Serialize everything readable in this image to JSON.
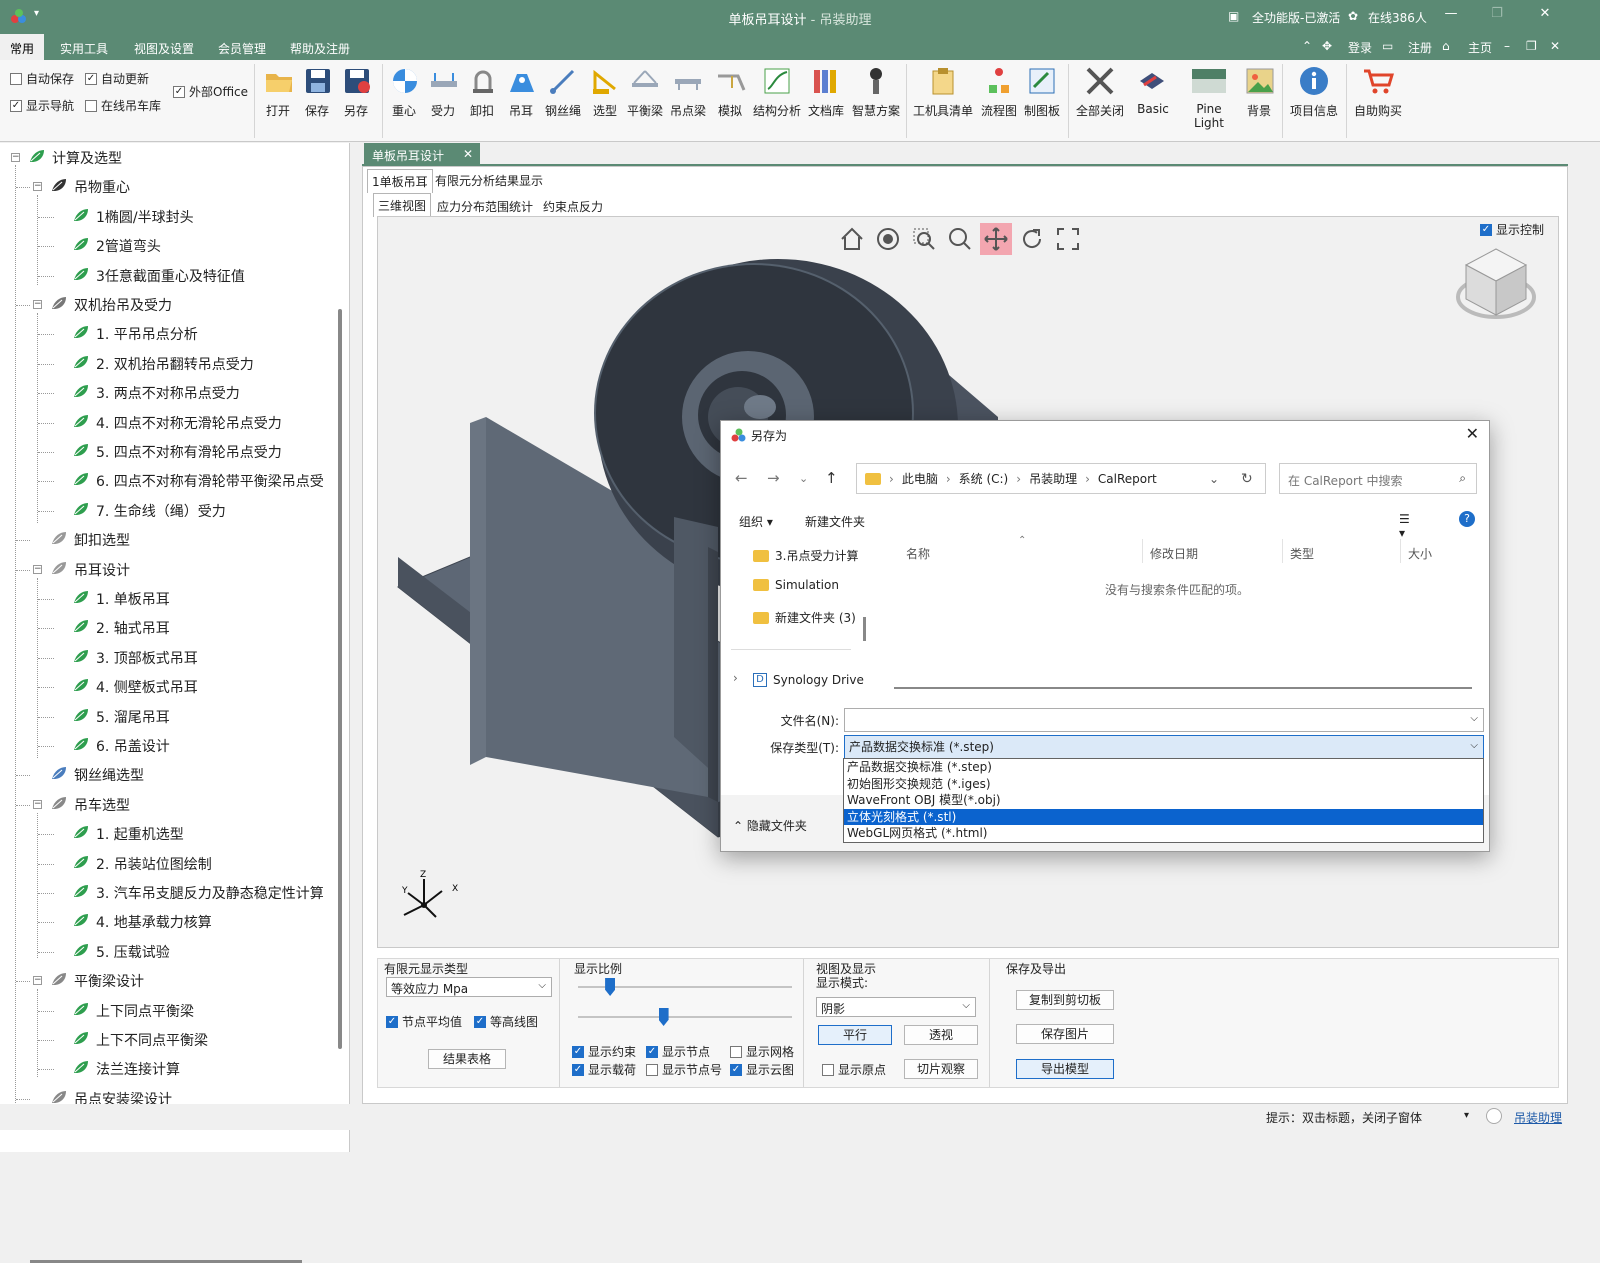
{
  "window": {
    "title": "单板吊耳设计",
    "title_sub": " - 吊装助理",
    "license": "全功能版-已激活",
    "online": "在线386人"
  },
  "menu": {
    "items": [
      "常用",
      "实用工具",
      "视图及设置",
      "会员管理",
      "帮助及注册"
    ],
    "right": {
      "login": "登录",
      "register": "注册",
      "home": "主页"
    }
  },
  "ribbon": {
    "checks": [
      {
        "label": "自动保存",
        "checked": false
      },
      {
        "label": "自动更新",
        "checked": true
      },
      {
        "label": "外部Office",
        "checked": true
      },
      {
        "label": "显示导航",
        "checked": true
      },
      {
        "label": "在线吊车库",
        "checked": false
      }
    ],
    "buttons": [
      "打开",
      "保存",
      "另存",
      "重心",
      "受力",
      "卸扣",
      "吊耳",
      "钢丝绳",
      "选型",
      "平衡梁",
      "吊点梁",
      "模拟",
      "结构分析",
      "文档库",
      "智慧方案",
      "工机具清单",
      "流程图",
      "制图板",
      "全部关闭",
      "Basic",
      "Pine Light",
      "背景",
      "项目信息",
      "自助购买"
    ]
  },
  "tree": {
    "items": [
      "计算及选型",
      "吊物重心",
      "1椭圆/半球封头",
      "2管道弯头",
      "3任意截面重心及特征值",
      "双机抬吊及受力",
      "1. 平吊吊点分析",
      "2. 双机抬吊翻转吊点受力",
      "3. 两点不对称吊点受力",
      "4. 四点不对称无滑轮吊点受力",
      "5. 四点不对称有滑轮吊点受力",
      "6. 四点不对称有滑轮带平衡梁吊点受",
      "7. 生命线（绳）受力",
      "卸扣选型",
      "吊耳设计",
      "1. 单板吊耳",
      "2. 轴式吊耳",
      "3. 顶部板式吊耳",
      "4. 侧壁板式吊耳",
      "5. 溜尾吊耳",
      "6. 吊盖设计",
      "钢丝绳选型",
      "吊车选型",
      "1. 起重机选型",
      "2. 吊装站位图绘制",
      "3. 汽车吊支腿反力及静态稳定性计算",
      "4. 地基承载力核算",
      "5. 压载试验",
      "平衡梁设计",
      "上下同点平衡梁",
      "上下不同点平衡梁",
      "法兰连接计算",
      "吊点安装梁设计"
    ]
  },
  "doc": {
    "tab": "单板吊耳设计",
    "subtabs": [
      "1单板吊耳",
      "有限元分析结果显示"
    ],
    "viewtabs": [
      "三维视图",
      "应力分布范围统计",
      "约束点反力"
    ],
    "show_control": "显示控制",
    "axes": {
      "x": "X",
      "y": "Y",
      "z": "Z"
    }
  },
  "bottom": {
    "fe_type": {
      "title": "有限元显示类型",
      "value": "等效应力 Mpa",
      "node_avg": "节点平均值",
      "contour": "等高线图",
      "result_table": "结果表格"
    },
    "scale": {
      "title": "显示比例",
      "slider1": 0.15,
      "slider2": 0.4,
      "checks": [
        {
          "label": "显示约束",
          "checked": true
        },
        {
          "label": "显示节点",
          "checked": true
        },
        {
          "label": "显示网格",
          "checked": false
        },
        {
          "label": "显示载荷",
          "checked": true
        },
        {
          "label": "显示节点号",
          "checked": false
        },
        {
          "label": "显示云图",
          "checked": true
        }
      ]
    },
    "view": {
      "title": "视图及显示",
      "mode_label": "显示模式:",
      "mode_value": "阴影",
      "parallel": "平行",
      "perspective": "透视",
      "show_origin": "显示原点",
      "slice": "切片观察"
    },
    "export": {
      "title": "保存及导出",
      "copy": "复制到剪切板",
      "save_image": "保存图片",
      "export_model": "导出模型"
    }
  },
  "status": {
    "hint": "提示：双击标题，关闭子窗体",
    "link": "吊装助理"
  },
  "dialog": {
    "title": "另存为",
    "path": [
      "此电脑",
      "系统 (C:)",
      "吊装助理",
      "CalReport"
    ],
    "search_placeholder": "在 CalReport 中搜索",
    "organize": "组织",
    "new_folder": "新建文件夹",
    "nav_items": [
      "3.吊点受力计算",
      "Simulation",
      "新建文件夹 (3)",
      "Synology Drive"
    ],
    "columns": [
      "名称",
      "修改日期",
      "类型",
      "大小"
    ],
    "empty": "没有与搜索条件匹配的项。",
    "filename_label": "文件名(N):",
    "filename_value": "",
    "savetype_label": "保存类型(T):",
    "savetype_value": "产品数据交换标准 (*.step)",
    "hide_folders": "隐藏文件夹",
    "type_options": [
      "产品数据交换标准 (*.step)",
      "初始图形交换规范 (*.iges)",
      "WaveFront OBJ 模型(*.obj)",
      "立体光刻格式 (*.stl)",
      "WebGL网页格式 (*.html)"
    ],
    "selected_option_index": 3
  },
  "colors": {
    "accent": "#5b8a74",
    "selection": "#0b63ce",
    "model": "#5d6775"
  }
}
